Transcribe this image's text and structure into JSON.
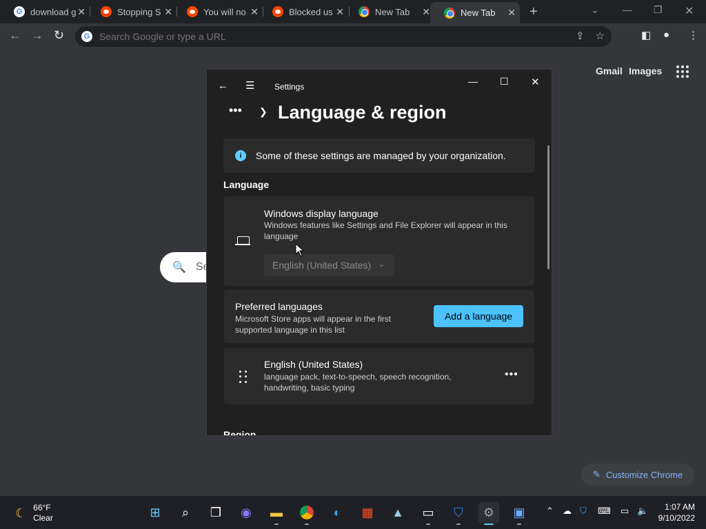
{
  "browser": {
    "tabs": [
      {
        "title": "download g",
        "favicon": "google"
      },
      {
        "title": "Stopping S",
        "favicon": "reddit"
      },
      {
        "title": "You will no",
        "favicon": "reddit"
      },
      {
        "title": "Blocked us",
        "favicon": "reddit"
      },
      {
        "title": "New Tab",
        "favicon": "chrome"
      },
      {
        "title": "New Tab",
        "favicon": "chrome"
      }
    ],
    "omnibox_placeholder": "Search Google or type a URL",
    "ntp": {
      "gmail": "Gmail",
      "images": "Images",
      "search_placeholder": "Se",
      "customize": "Customize Chrome"
    }
  },
  "settings": {
    "window_title": "Settings",
    "breadcrumb_more": "•••",
    "page_title": "Language & region",
    "info_text": "Some of these settings are managed by your organization.",
    "language_section": "Language",
    "display_language": {
      "title": "Windows display language",
      "desc": "Windows features like Settings and File Explorer will appear in this language",
      "value": "English (United States)"
    },
    "preferred": {
      "title": "Preferred languages",
      "desc": "Microsoft Store apps will appear in the first supported language in this list",
      "button": "Add a language"
    },
    "installed_language": {
      "title": "English (United States)",
      "desc": "language pack, text-to-speech, speech recognition, handwriting, basic typing"
    },
    "region_section": "Region"
  },
  "taskbar": {
    "weather_temp": "66°F",
    "weather_desc": "Clear",
    "time": "1:07 AM",
    "date": "9/10/2022"
  },
  "colors": {
    "accent": "#4cc2ff",
    "chrome_dark": "#35363a",
    "settings_bg": "#202020"
  }
}
